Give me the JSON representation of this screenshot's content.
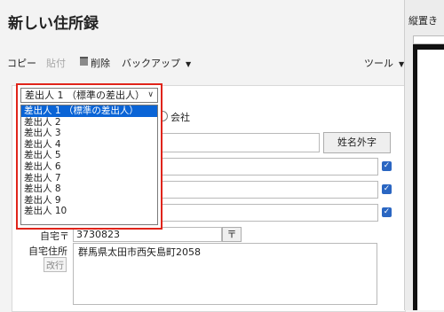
{
  "window": {
    "title": "新しい住所録"
  },
  "toolbar": {
    "copy": "コピー",
    "paste": "貼付",
    "delete": "削除",
    "backup": "バックアップ",
    "tools": "ツール"
  },
  "form": {
    "radio_company": "会社",
    "name_gaiji_button": "姓名外字",
    "zip_label": "自宅〒",
    "zip_value": "3730823",
    "zip_button": "〒",
    "address_label": "自宅住所",
    "newline_button": "改行",
    "address_value": "群馬県太田市西矢島町2058"
  },
  "sender_select": {
    "selected": "差出人 1 （標準の差出人）",
    "options": [
      "差出人 1 （標準の差出人）",
      "差出人 2",
      "差出人 3",
      "差出人 4",
      "差出人 5",
      "差出人 6",
      "差出人 7",
      "差出人 8",
      "差出人 9",
      "差出人 10"
    ],
    "selected_index": 0
  },
  "right_panel": {
    "title": "縦置き"
  },
  "colors": {
    "highlight": "#e0241a",
    "selection": "#0a64d6",
    "checkbox": "#2a66c2"
  },
  "icons": {
    "delete": "trash-icon",
    "dropdown": "chevron-down-icon"
  }
}
